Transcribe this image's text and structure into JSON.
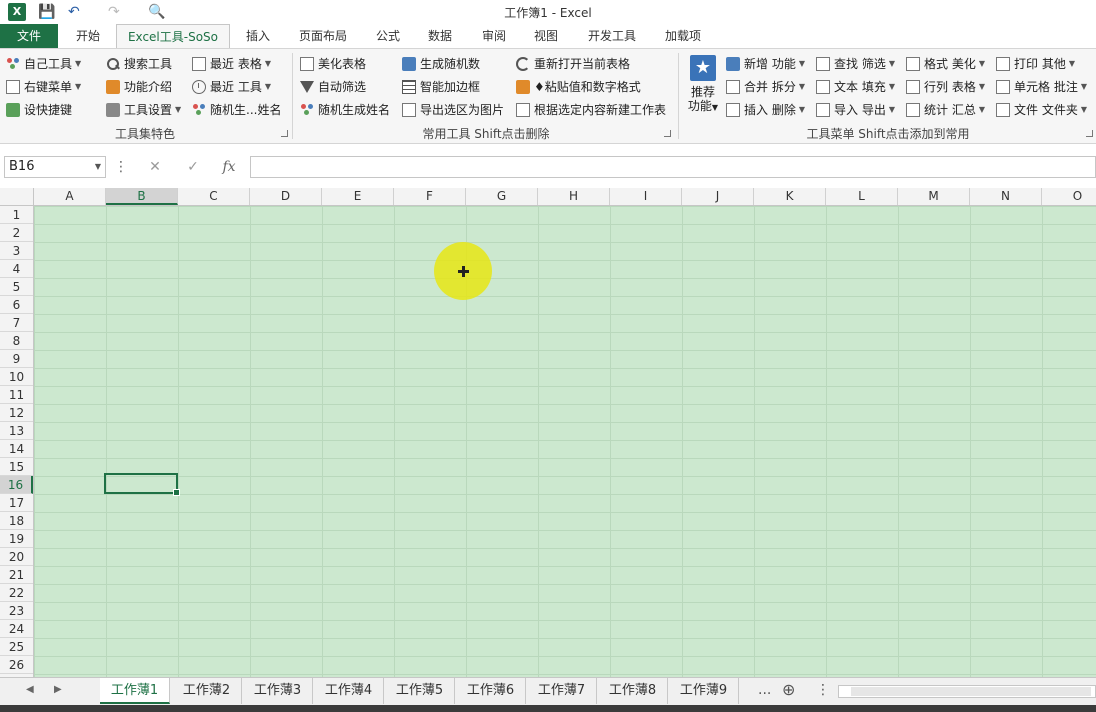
{
  "titlebar": {
    "logo_text": "X",
    "title": "工作簿1 - Excel",
    "save_glyph": "💾",
    "undo_glyph": "↶",
    "redo_glyph": "↷",
    "preview_glyph": "🔍"
  },
  "tabs": [
    {
      "label": "文件"
    },
    {
      "label": "开始"
    },
    {
      "label": "Excel工具-SoSo"
    },
    {
      "label": "插入"
    },
    {
      "label": "页面布局"
    },
    {
      "label": "公式"
    },
    {
      "label": "数据"
    },
    {
      "label": "审阅"
    },
    {
      "label": "视图"
    },
    {
      "label": "开发工具"
    },
    {
      "label": "加载项"
    }
  ],
  "ribbon": {
    "group1": {
      "label": "工具集特色",
      "items": [
        "自己工具",
        "右键菜单",
        "设快捷键",
        "搜索工具",
        "功能介绍",
        "工具设置",
        "最近  表格",
        "最近  工具",
        "随机生...姓名"
      ]
    },
    "group2": {
      "label": "常用工具 Shift点击删除",
      "items": [
        "美化表格",
        "自动筛选",
        "随机生成姓名",
        "生成随机数",
        "智能加边框",
        "导出选区为图片",
        "重新打开当前表格",
        "♦粘贴值和数字格式",
        "根据选定内容新建工作表"
      ]
    },
    "group3": {
      "label": "工具菜单 Shift点击添加到常用",
      "big_button": {
        "line1": "推荐",
        "line2": "功能"
      },
      "items": [
        "新增 功能",
        "合并 拆分",
        "插入 删除",
        "查找 筛选",
        "文本 填充",
        "导入 导出",
        "格式 美化",
        "行列 表格",
        "统计 汇总",
        "打印 其他",
        "单元格 批注",
        "文件 文件夹"
      ]
    }
  },
  "formula_bar": {
    "name_box": "B16",
    "more": "⋮",
    "cancel": "✕",
    "enter": "✓",
    "fx": "fx",
    "value": ""
  },
  "grid": {
    "columns": [
      "A",
      "B",
      "C",
      "D",
      "E",
      "F",
      "G",
      "H",
      "I",
      "J",
      "K",
      "L",
      "M",
      "N",
      "O"
    ],
    "rows": [
      "1",
      "2",
      "3",
      "4",
      "5",
      "6",
      "7",
      "8",
      "9",
      "10",
      "11",
      "12",
      "13",
      "14",
      "15",
      "16",
      "17",
      "18",
      "19",
      "20",
      "21",
      "22",
      "23",
      "24",
      "25",
      "26"
    ],
    "selected_col": "B",
    "selected_row": "16"
  },
  "sheets": {
    "tabs": [
      "工作薄1",
      "工作薄2",
      "工作薄3",
      "工作薄4",
      "工作薄5",
      "工作薄6",
      "工作薄7",
      "工作薄8",
      "工作薄9"
    ],
    "active": "工作薄1",
    "more": "...",
    "add": "⊕",
    "prev": "◀",
    "next": "▶"
  }
}
